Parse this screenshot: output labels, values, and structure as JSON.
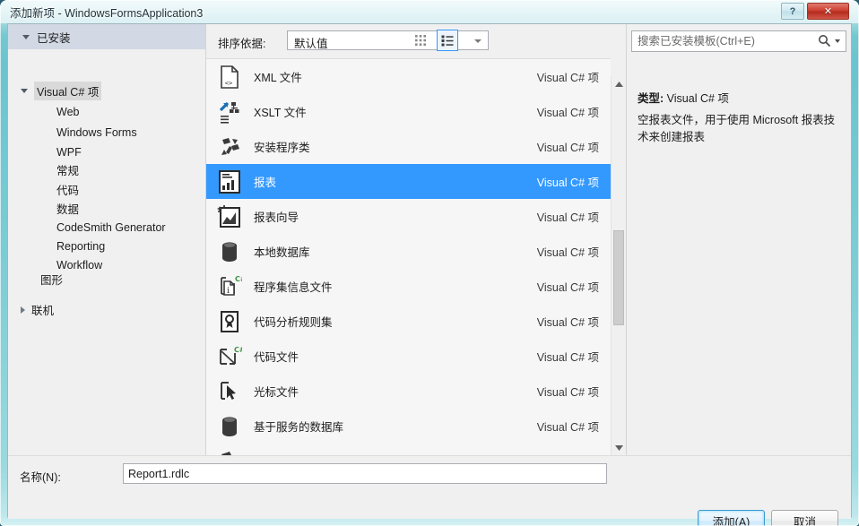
{
  "window": {
    "title": "添加新项 - WindowsFormsApplication3",
    "help_label": "?",
    "close_label": "✕"
  },
  "tree": {
    "installed_label": "已安装",
    "root": {
      "label": "Visual C# 项",
      "children": [
        {
          "label": "Web"
        },
        {
          "label": "Windows Forms"
        },
        {
          "label": "WPF"
        },
        {
          "label": "常规"
        },
        {
          "label": "代码"
        },
        {
          "label": "数据"
        },
        {
          "label": "CodeSmith Generator"
        },
        {
          "label": "Reporting"
        },
        {
          "label": "Workflow"
        }
      ]
    },
    "graphics_label": "图形",
    "online_label": "联机"
  },
  "toolbar": {
    "sort_label": "排序依据:",
    "sort_value": "默认值",
    "grid_view_name": "grid-view-icon",
    "list_view_name": "list-view-icon"
  },
  "list": {
    "items": [
      {
        "name": "XML 文件",
        "kind": "Visual C# 项",
        "icon": "xml-file-icon",
        "selected": false
      },
      {
        "name": "XSLT 文件",
        "kind": "Visual C# 项",
        "icon": "xslt-file-icon",
        "selected": false
      },
      {
        "name": "安装程序类",
        "kind": "Visual C# 项",
        "icon": "installer-class-icon",
        "selected": false
      },
      {
        "name": "报表",
        "kind": "Visual C# 项",
        "icon": "report-icon",
        "selected": true
      },
      {
        "name": "报表向导",
        "kind": "Visual C# 项",
        "icon": "report-wizard-icon",
        "selected": false
      },
      {
        "name": "本地数据库",
        "kind": "Visual C# 项",
        "icon": "local-database-icon",
        "selected": false
      },
      {
        "name": "程序集信息文件",
        "kind": "Visual C# 项",
        "icon": "assembly-info-icon",
        "selected": false
      },
      {
        "name": "代码分析规则集",
        "kind": "Visual C# 项",
        "icon": "code-analysis-ruleset-icon",
        "selected": false
      },
      {
        "name": "代码文件",
        "kind": "Visual C# 项",
        "icon": "code-file-icon",
        "selected": false
      },
      {
        "name": "光标文件",
        "kind": "Visual C# 项",
        "icon": "cursor-file-icon",
        "selected": false
      },
      {
        "name": "基于服务的数据库",
        "kind": "Visual C# 项",
        "icon": "service-database-icon",
        "selected": false
      }
    ]
  },
  "search": {
    "placeholder": "搜索已安装模板(Ctrl+E)"
  },
  "details": {
    "type_label": "类型:",
    "type_value": "Visual C# 项",
    "description": "空报表文件，用于使用 Microsoft 报表技术来创建报表"
  },
  "name_field": {
    "label": "名称(N):",
    "value": "Report1.rdlc"
  },
  "footer": {
    "add_label": "添加(A)",
    "cancel_label": "取消"
  },
  "colors": {
    "selection_blue": "#3399ff",
    "glass_teal": "#74c7d0",
    "close_red": "#cc4133"
  }
}
